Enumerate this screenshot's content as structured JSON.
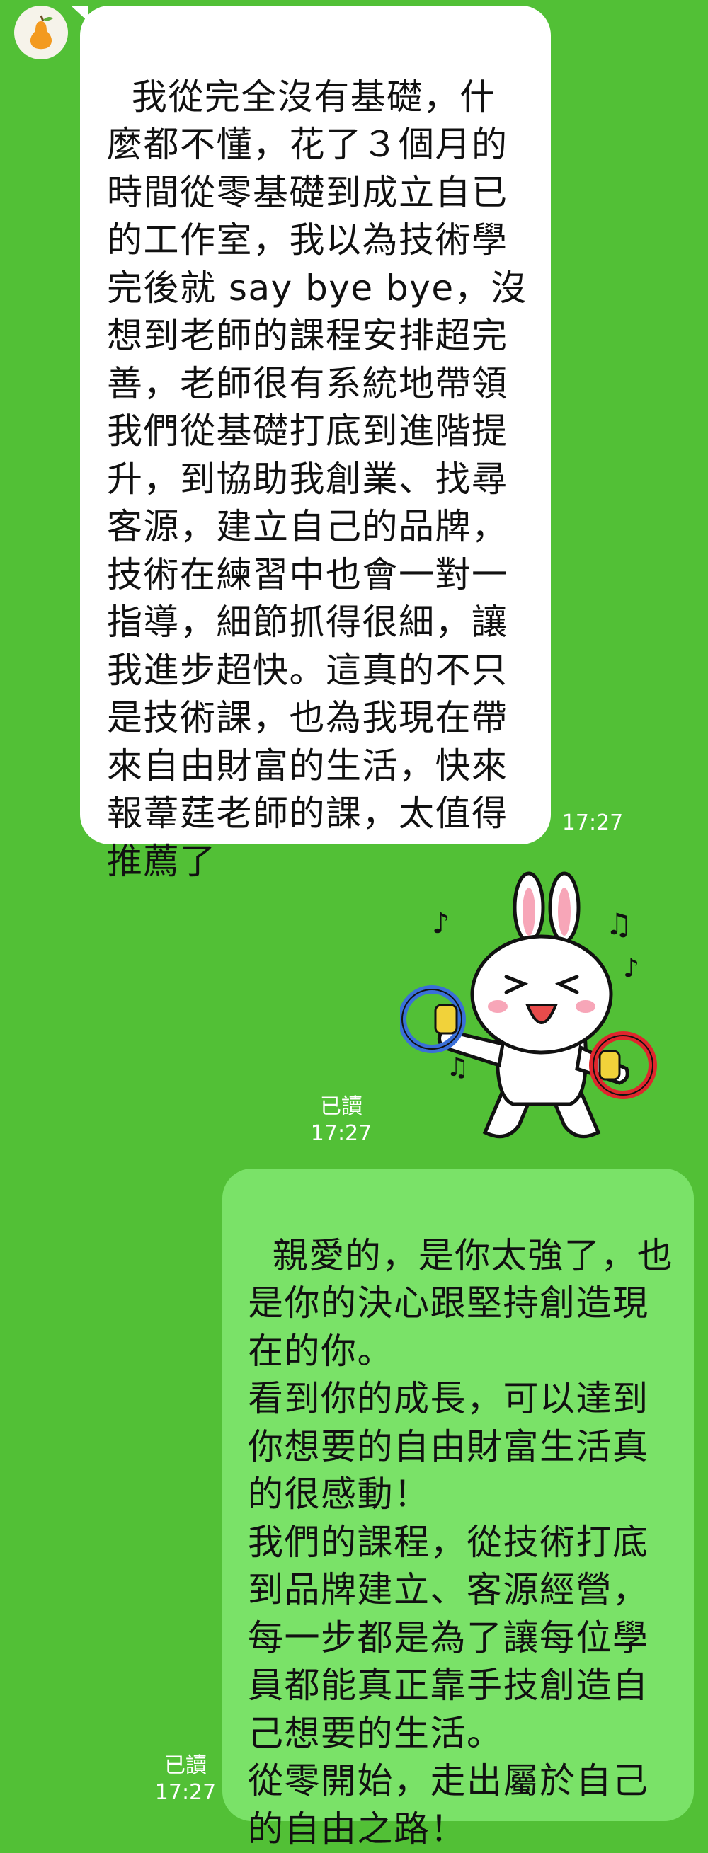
{
  "messages": [
    {
      "side": "incoming",
      "avatar_icon": "pear-icon",
      "text": "我從完全沒有基礎，什麼都不懂，花了３個月的時間從零基礎到成立自已的工作室，我以為技術學完後就 say bye bye，沒想到老師的課程安排超完善，老師很有系統地帶領我們從基礎打底到進階提升，到協助我創業、找尋客源，建立自己的品牌，技術在練習中也會一對一指導，細節抓得很細，讓我進步超快。這真的不只是技術課，也為我現在帶來自由財富的生活，快來報葦莛老師的課，太值得推薦了",
      "time": "17:27"
    },
    {
      "side": "outgoing",
      "type": "sticker",
      "sticker_icon": "cony-rabbit-tambourine-sticker",
      "read_label": "已讀",
      "time": "17:27"
    },
    {
      "side": "outgoing",
      "text": "親愛的，是你太強了，也是你的決心跟堅持創造現在的你。\n看到你的成長，可以達到你想要的自由財富生活真的很感動！\n我們的課程，從技術打底到品牌建立、客源經營，每一步都是為了讓每位學員都能真正靠手技創造自己想要的生活。\n從零開始，走出屬於自己的自由之路！",
      "read_label": "已讀",
      "time": "17:27"
    }
  ],
  "colors": {
    "chat_background": "#52c036",
    "incoming_bubble": "#ffffff",
    "outgoing_bubble": "#7ae268"
  }
}
